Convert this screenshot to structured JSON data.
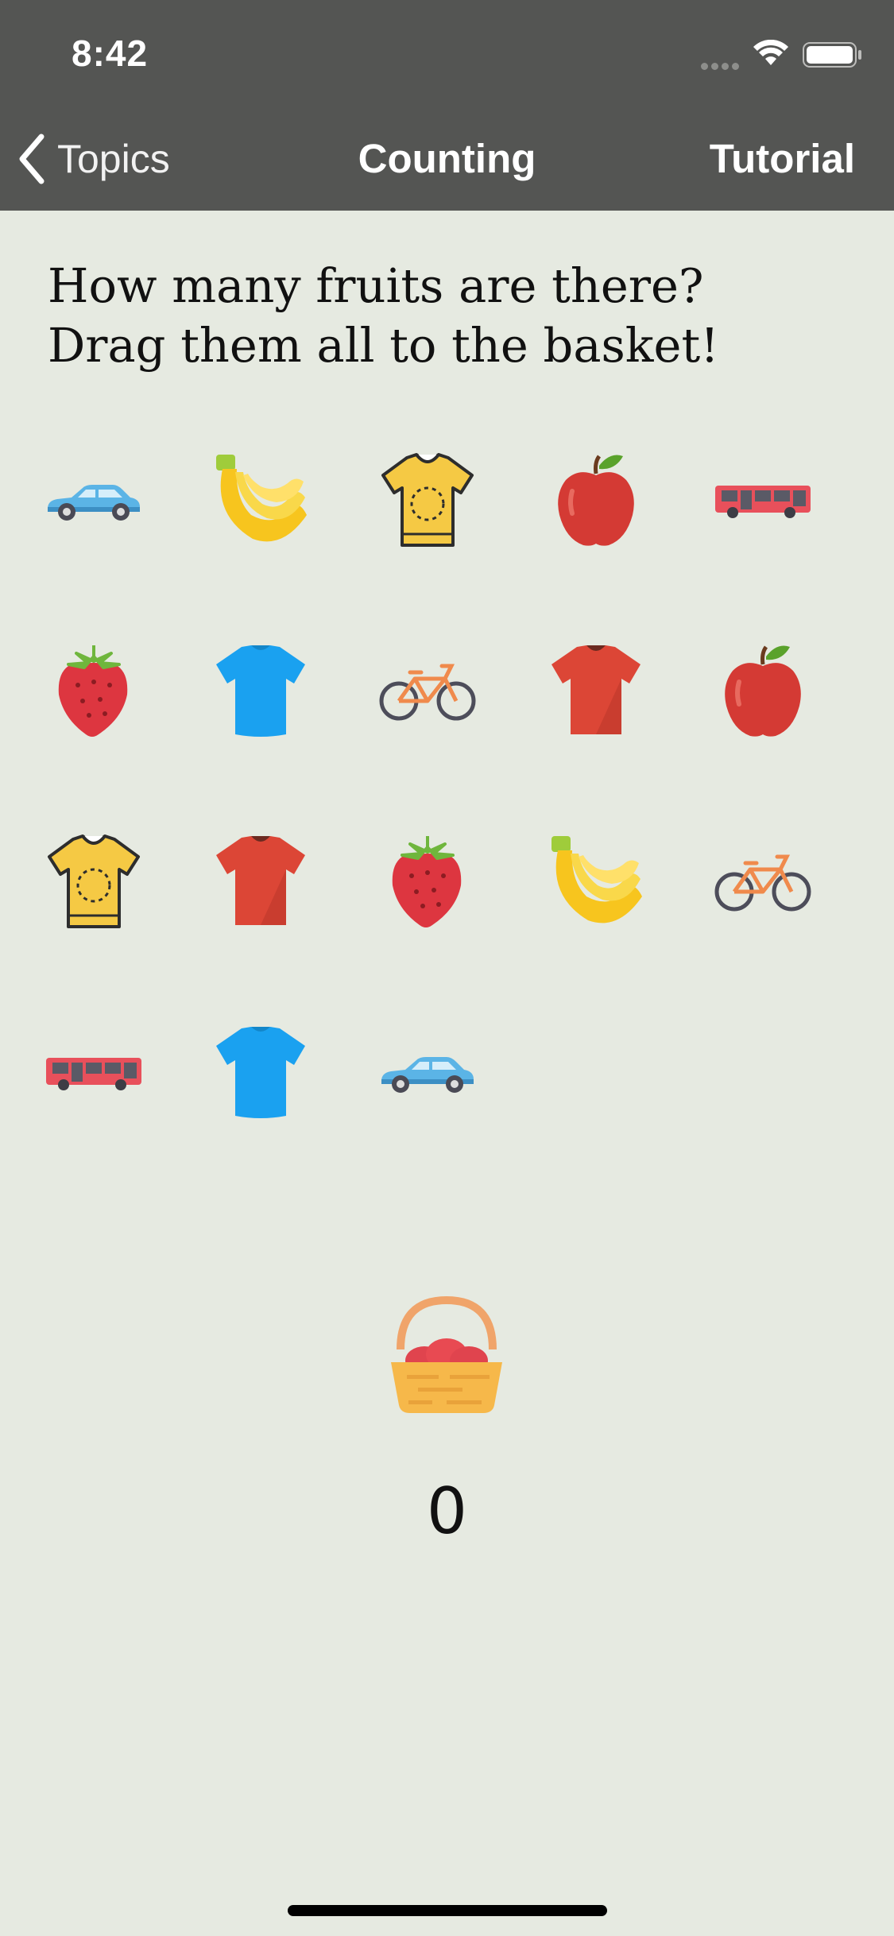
{
  "status_bar": {
    "time": "8:42"
  },
  "nav": {
    "back_label": "Topics",
    "title": "Counting",
    "tutorial_label": "Tutorial"
  },
  "question": {
    "line1": "How many fruits are there?",
    "line2": "Drag them all to the basket!"
  },
  "items": [
    [
      "car-icon",
      "banana-icon",
      "yellow-shirt-icon",
      "apple-icon",
      "bus-icon"
    ],
    [
      "strawberry-icon",
      "blue-shirt-icon",
      "bicycle-icon",
      "red-shirt-icon",
      "apple-icon"
    ],
    [
      "yellow-shirt-icon",
      "red-shirt-icon",
      "strawberry-icon",
      "banana-icon",
      "bicycle-icon"
    ],
    [
      "bus-icon",
      "blue-shirt-icon",
      "car-icon"
    ]
  ],
  "basket": {
    "icon": "basket-icon",
    "count": "0"
  },
  "colors": {
    "background": "#e6eae1",
    "header": "#545553"
  }
}
